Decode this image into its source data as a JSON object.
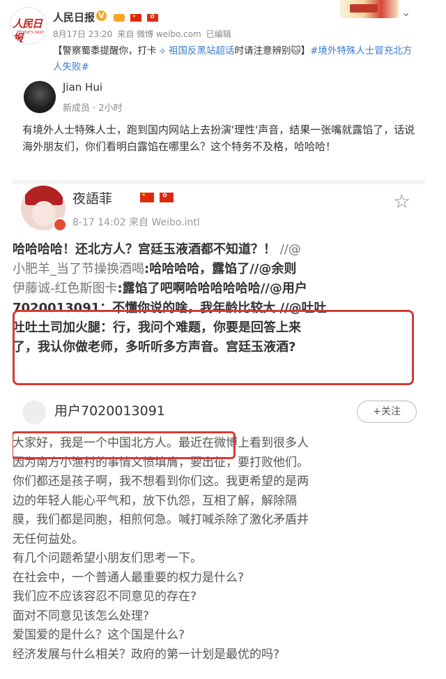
{
  "post": {
    "author": "人民日报",
    "logo_text": "人民日报",
    "logo_sub": "PEOPLE'S DAILY",
    "date": "8月17日 23:20",
    "source": "来自 微博 weibo.com",
    "edited": "已编辑",
    "text_part1": "【警察蜀黍提醒你，打卡 ",
    "text_link": "祖国反黑站超话",
    "text_part2": "时请注意辨别",
    "text_hashtag": "#境外特殊人士冒充北方人失败#",
    "text_close": "】"
  },
  "screenshot": {
    "card1": {
      "name": "Jian Hui",
      "subtitle": "新成员 · 2小时",
      "text": "有境外人士特殊人士，跑到国内网站上去扮演'理性'声音，结果一张嘴就露馅了，话说海外朋友们，你们看明白露馅在哪里么？这个特务不及格，哈哈哈！"
    },
    "card2": {
      "name": "夜語菲",
      "meta": "8-17 14:02  来自 Weibo.intl",
      "line1_bold": "哈哈哈哈！还北方人？宫廷玉液酒都不知道？！",
      "line1_mention": " //@",
      "line2_mention": "小肥羊_当了节操换酒喝",
      "line2_rest": ":哈哈哈哈，露馅了//@余则",
      "line3_mention": "伊藤诚-红色斯图卡",
      "line3_rest": ":露馅了吧啊哈哈哈哈哈哈//@用户",
      "line4": "7020013091：不懂你说的啥，我年龄比较大 //@吐吐",
      "line5": "吐吐土司加火腿：行，我问个难题，你要是回答上来",
      "line6": "了，我认你做老师，多听听多方声音。宫廷玉液酒?"
    },
    "card3": {
      "name": "用户7020013091",
      "follow_label": "+关注",
      "lines": [
        "大家好，我是一个中国北方人。最近在微博上看到很多人",
        "因为南方小渔村的事情义愤填膺，要出征，要打败他们。",
        "你们都还是孩子啊，我不想看到你们这。我更希望的是两",
        "边的年轻人能心平气和，放下仇怨，互相了解，解除隔",
        "膜，我们都是同胞，相煎何急。喊打喊杀除了激化矛盾并",
        "无任何益处。",
        "有几个问题希望小朋友们思考一下。",
        "在社会中，一个普通人最重要的权力是什么?",
        "我们应不应该容忍不同意见的存在?",
        "面对不同意见该怎么处理?",
        "爱国爱的是什么？这个国是什么?",
        "经济发展与什么相关？政府的第一计划是最优的吗?"
      ]
    }
  },
  "colors": {
    "accent_orange": "#eb7350",
    "link_blue": "#3c7bd1",
    "box_red": "#d23b32"
  }
}
